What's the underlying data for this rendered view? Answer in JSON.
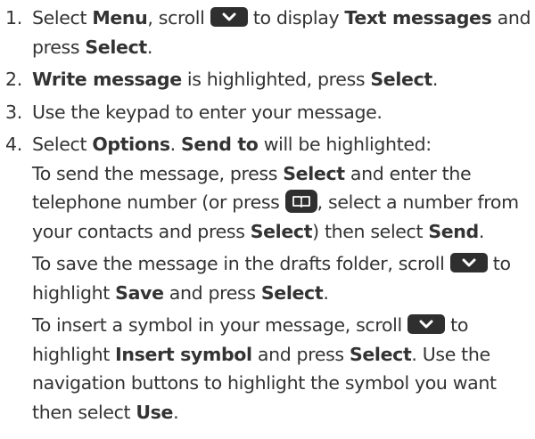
{
  "steps": [
    {
      "number": "1.",
      "parts": [
        "Select ",
        "Menu",
        ", scroll ",
        " to display ",
        "Text messages",
        " and press ",
        "Select",
        "."
      ]
    },
    {
      "number": "2.",
      "parts": [
        "Write message",
        " is highlighted, press ",
        "Select",
        "."
      ]
    },
    {
      "number": "3.",
      "parts": [
        "Use the keypad to enter your message."
      ]
    },
    {
      "number": "4.",
      "parts": [
        "Select ",
        "Options",
        ". ",
        "Send to",
        " will be highlighted:"
      ]
    }
  ],
  "subs": {
    "send": [
      "To send the message, press ",
      "Select",
      " and enter the telephone number (or press ",
      ", select a number from your contacts and press ",
      "Select",
      ") then select ",
      "Send",
      "."
    ],
    "save": [
      "To save the message in the drafts folder, scroll ",
      " to highlight ",
      "Save",
      " and press ",
      "Select",
      "."
    ],
    "insert": [
      "To insert a symbol in your message, scroll ",
      " to highlight ",
      "Insert symbol",
      " and press ",
      "Select",
      ". Use the navigation buttons to highlight the symbol you want then select ",
      "Use",
      "."
    ]
  },
  "icons": {
    "scroll_down": "chevron-down-key",
    "contacts": "phonebook-key"
  },
  "colors": {
    "text": "#333333",
    "key_fill": "#2f2f2f",
    "key_glyph": "#ffffff"
  }
}
